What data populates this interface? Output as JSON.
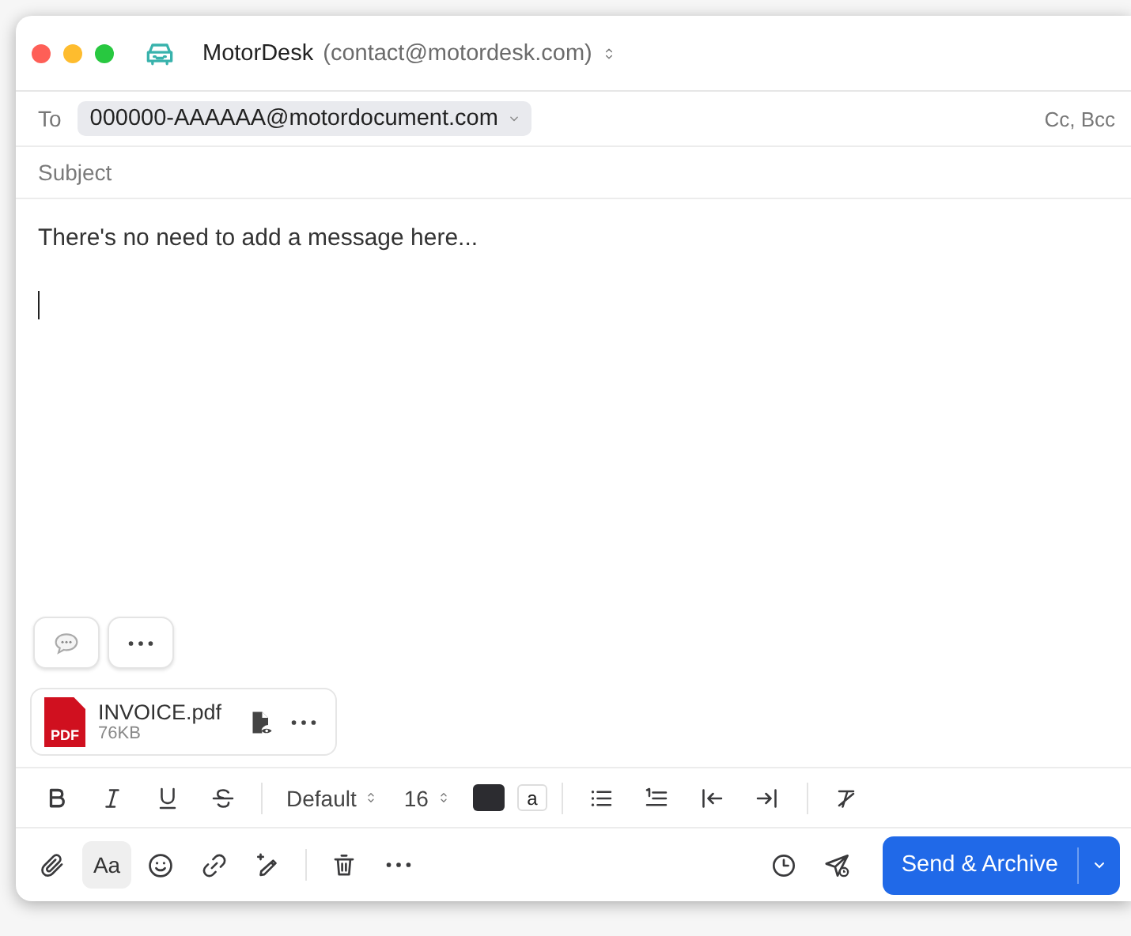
{
  "window": {
    "account_name": "MotorDesk",
    "account_email": "(contact@motordesk.com)"
  },
  "to": {
    "label": "To",
    "recipients": [
      "000000-AAAAAA@motordocument.com"
    ],
    "cc_bcc": "Cc, Bcc"
  },
  "subject": {
    "placeholder": "Subject"
  },
  "body": {
    "value": "There's no need to add a message here..."
  },
  "attachments": [
    {
      "name": "INVOICE.pdf",
      "size": "76KB",
      "badge": "PDF"
    }
  ],
  "format_toolbar": {
    "font": "Default",
    "size": "16",
    "highlight": "a"
  },
  "bottom_toolbar": {
    "format_toggle": {
      "label": "Aa",
      "selected": true
    }
  },
  "send_button": {
    "label": "Send & Archive"
  }
}
